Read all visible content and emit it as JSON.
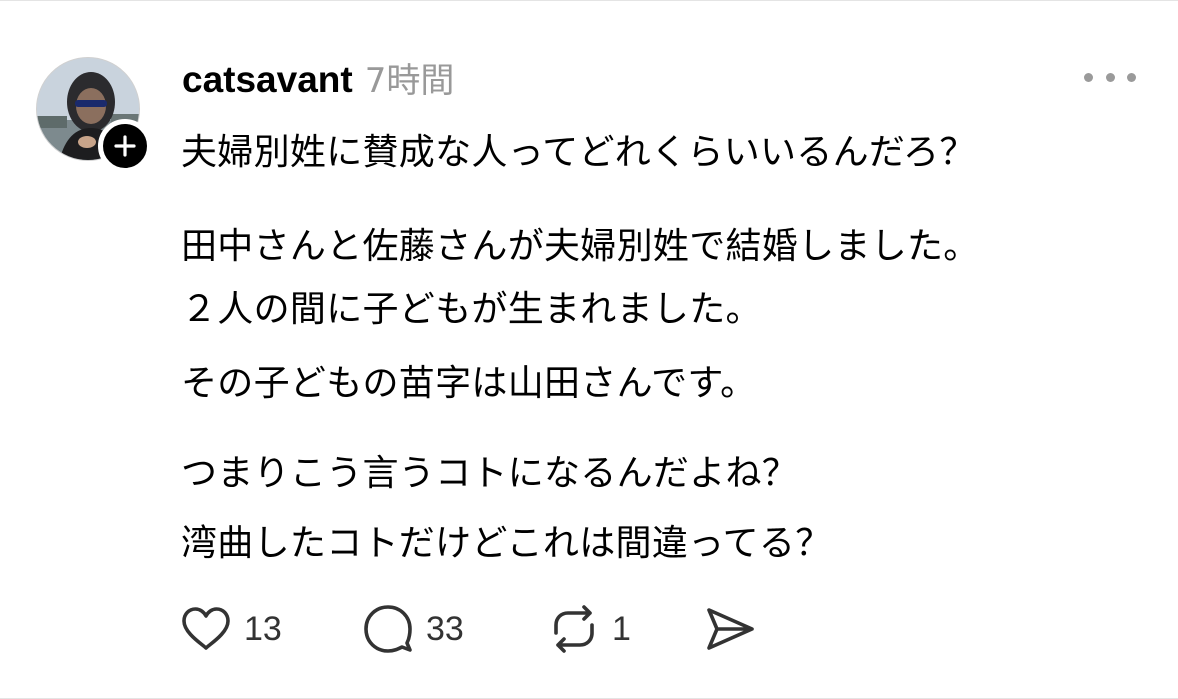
{
  "post": {
    "username": "catsavant",
    "timestamp": "7時間",
    "lines": [
      "夫婦別姓に賛成な人ってどれくらいいるんだろ？",
      "田中さんと佐藤さんが夫婦別姓で結婚しました。",
      "２人の間に子どもが生まれました。",
      "その子どもの苗字は山田さんです。",
      "つまりこう言うコトになるんだよね？",
      "湾曲したコトだけどこれは間違ってる？"
    ]
  },
  "actions": {
    "like_count": "13",
    "reply_count": "33",
    "repost_count": "1"
  },
  "icons": {
    "follow": "plus-icon",
    "more": "more-horizontal-icon",
    "like": "heart-icon",
    "reply": "speech-bubble-icon",
    "repost": "repost-arrows-icon",
    "share": "paper-plane-icon"
  },
  "colors": {
    "text": "#000000",
    "muted": "#999999",
    "icon": "#333333"
  }
}
